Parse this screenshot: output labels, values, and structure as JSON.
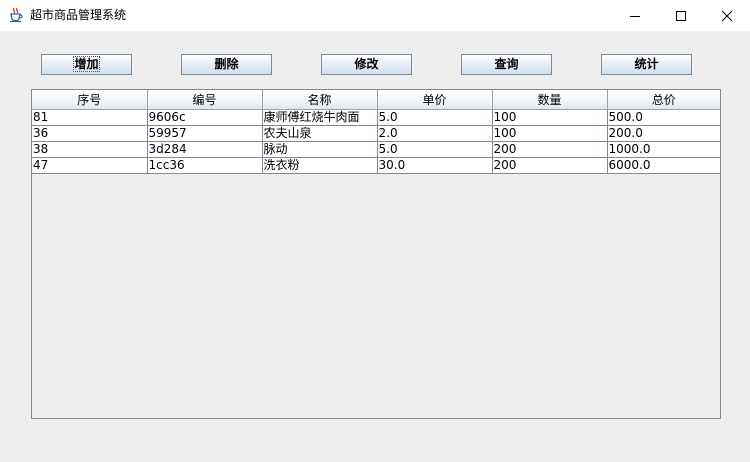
{
  "window": {
    "title": "超市商品管理系统",
    "icon": "java-coffee-cup-icon"
  },
  "toolbar": {
    "add_label": "增加",
    "delete_label": "删除",
    "edit_label": "修改",
    "query_label": "查询",
    "stats_label": "统计"
  },
  "table": {
    "columns": [
      "序号",
      "编号",
      "名称",
      "单价",
      "数量",
      "总价"
    ],
    "rows": [
      [
        "81",
        "9606c",
        "康师傅红烧牛肉面",
        "5.0",
        "100",
        "500.0"
      ],
      [
        "36",
        "59957",
        "农夫山泉",
        "2.0",
        "100",
        "200.0"
      ],
      [
        "38",
        "3d284",
        "脉动",
        "5.0",
        "200",
        "1000.0"
      ],
      [
        "47",
        "1cc36",
        "洗衣粉",
        "30.0",
        "200",
        "6000.0"
      ]
    ]
  }
}
